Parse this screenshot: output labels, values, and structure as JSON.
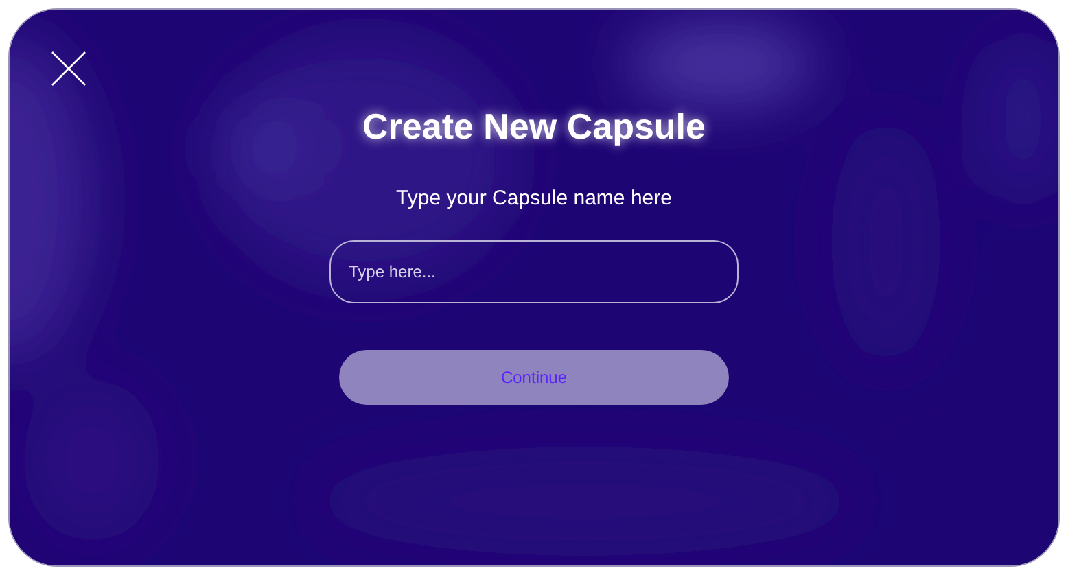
{
  "dialog": {
    "title": "Create New Capsule",
    "subtitle": "Type your Capsule name here",
    "name_field": {
      "placeholder": "Type here..."
    },
    "continue_button": {
      "label": "Continue",
      "disabled": true
    }
  }
}
